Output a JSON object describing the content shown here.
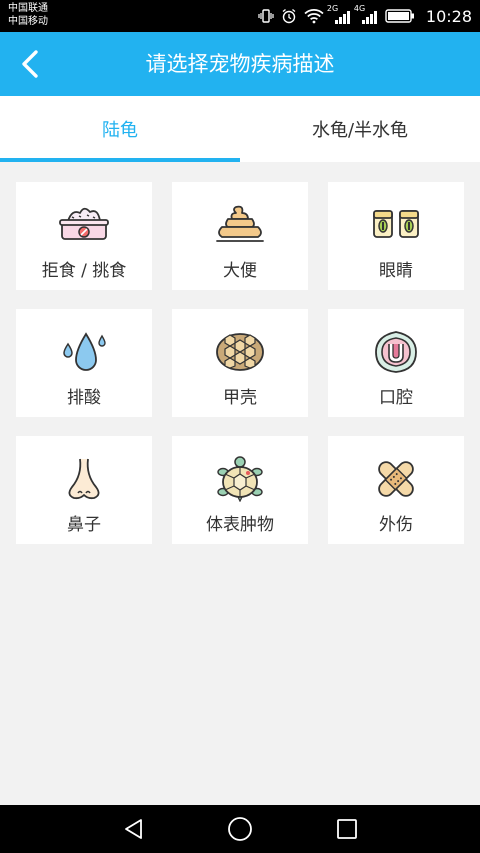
{
  "status_bar": {
    "carrier1": "中国联通",
    "carrier2": "中国移动",
    "net1": "2G",
    "net2": "4G",
    "time": "10:28"
  },
  "header": {
    "title": "请选择宠物疾病描述"
  },
  "tabs": [
    {
      "label": "陆龟",
      "active": true
    },
    {
      "label": "水龟/半水龟",
      "active": false
    }
  ],
  "items": [
    {
      "label": "拒食 / 挑食",
      "icon": "food-bowl-icon"
    },
    {
      "label": "大便",
      "icon": "poop-icon"
    },
    {
      "label": "眼睛",
      "icon": "eyes-icon"
    },
    {
      "label": "排酸",
      "icon": "water-drops-icon"
    },
    {
      "label": "甲壳",
      "icon": "turtle-shell-icon"
    },
    {
      "label": "口腔",
      "icon": "mouth-icon"
    },
    {
      "label": "鼻子",
      "icon": "nose-icon"
    },
    {
      "label": "体表肿物",
      "icon": "turtle-icon"
    },
    {
      "label": "外伤",
      "icon": "bandage-icon"
    }
  ],
  "colors": {
    "accent": "#22b2f0",
    "background": "#f2f2f2"
  }
}
